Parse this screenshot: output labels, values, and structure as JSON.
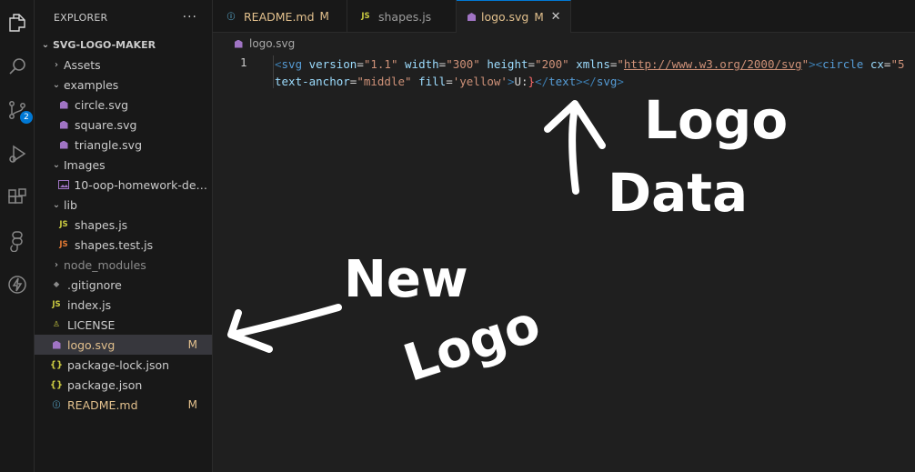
{
  "explorer": {
    "title": "EXPLORER",
    "more": "···",
    "scm_badge": "2",
    "root": "SVG-LOGO-MAKER",
    "items": [
      {
        "label": "Assets"
      },
      {
        "label": "examples"
      },
      {
        "label": "circle.svg"
      },
      {
        "label": "square.svg"
      },
      {
        "label": "triangle.svg"
      },
      {
        "label": "Images"
      },
      {
        "label": "10-oop-homework-dem..."
      },
      {
        "label": "lib"
      },
      {
        "label": "shapes.js"
      },
      {
        "label": "shapes.test.js"
      },
      {
        "label": "node_modules"
      },
      {
        "label": ".gitignore"
      },
      {
        "label": "index.js"
      },
      {
        "label": "LICENSE"
      },
      {
        "label": "logo.svg",
        "status": "M"
      },
      {
        "label": "package-lock.json"
      },
      {
        "label": "package.json"
      },
      {
        "label": "README.md",
        "status": "M"
      }
    ]
  },
  "icons": {
    "js": "JS",
    "json": "{}"
  },
  "tabs": [
    {
      "label": "README.md",
      "status": "M"
    },
    {
      "label": "shapes.js",
      "status": ""
    },
    {
      "label": "logo.svg",
      "status": "M",
      "close": "✕"
    }
  ],
  "editor": {
    "breadcrumb": "logo.svg",
    "line_number": "1",
    "tokens": {
      "open_lt": "<",
      "svg": "svg",
      "a_version": " version",
      "eq": "=",
      "v_version": "\"1.1\"",
      "a_width": " width",
      "v_width": "\"300\"",
      "a_height": " height",
      "v_height": "\"200\"",
      "a_xmlns": " xmlns",
      "q": "\"",
      "v_xmlns": "http://www.w3.org/2000/svg",
      "gt_lt": "><",
      "circle": "circle",
      "a_cx": " cx",
      "v_cx": "\"5",
      "a_anchor": "text-anchor",
      "v_anchor": "\"middle\"",
      "a_fill": " fill",
      "v_fill": "'yellow'",
      "close_gt": ">",
      "text_content": "U:",
      "brace": "}",
      "lt_slash": "</",
      "text_tag": "text",
      "svg_tag": "svg"
    }
  },
  "annotations": {
    "logo_data_1": "Logo",
    "logo_data_2": "Data",
    "new_logo_1": "New",
    "new_logo_2": "Logo"
  }
}
